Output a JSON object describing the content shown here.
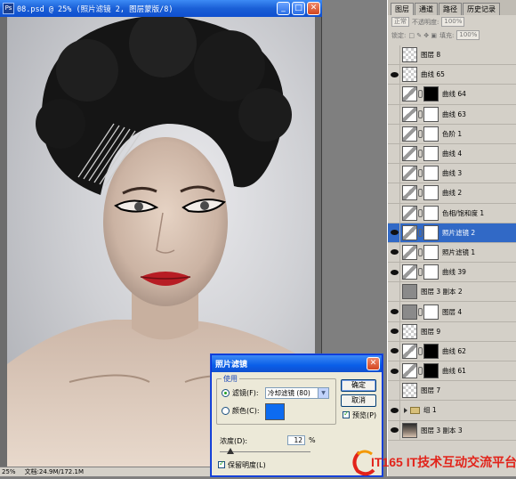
{
  "document": {
    "title": "08.psd @ 25% (照片滤镜 2, 图层蒙版/8)",
    "status_zoom": "25%",
    "status_doc": "文档:24.9M/172.1M"
  },
  "layers_panel": {
    "tabs": [
      "图层",
      "通道",
      "路径",
      "历史记录"
    ],
    "active_tab": "图层",
    "blend_mode": "正常",
    "opacity_label": "不透明度:",
    "opacity_value": "100%",
    "lock_label": "锁定:",
    "fill_label": "填充:",
    "fill_value": "100%",
    "layers": [
      {
        "name": "图层 8",
        "visible": false,
        "thumb": "checker",
        "mask": "none"
      },
      {
        "name": "曲线 65",
        "visible": true,
        "thumb": "checker",
        "mask": "none"
      },
      {
        "name": "曲线 64",
        "visible": false,
        "thumb": "adj",
        "mask": "black"
      },
      {
        "name": "曲线 63",
        "visible": false,
        "thumb": "adj",
        "mask": "white"
      },
      {
        "name": "色阶 1",
        "visible": false,
        "thumb": "adj",
        "mask": "white"
      },
      {
        "name": "曲线 4",
        "visible": false,
        "thumb": "adj",
        "mask": "white"
      },
      {
        "name": "曲线 3",
        "visible": false,
        "thumb": "adj",
        "mask": "white"
      },
      {
        "name": "曲线 2",
        "visible": false,
        "thumb": "adj",
        "mask": "white"
      },
      {
        "name": "色相/饱和度 1",
        "visible": false,
        "thumb": "adj",
        "mask": "white"
      },
      {
        "name": "照片滤镜 2",
        "visible": true,
        "thumb": "adj",
        "mask": "white",
        "selected": true
      },
      {
        "name": "照片滤镜 1",
        "visible": true,
        "thumb": "adj",
        "mask": "white"
      },
      {
        "name": "曲线 39",
        "visible": true,
        "thumb": "adj",
        "mask": "white"
      },
      {
        "name": "图层 3 副本 2",
        "visible": false,
        "thumb": "gray",
        "mask": "none"
      },
      {
        "name": "图层 4",
        "visible": true,
        "thumb": "gray",
        "mask": "white"
      },
      {
        "name": "图层 9",
        "visible": true,
        "thumb": "checker",
        "mask": "none"
      },
      {
        "name": "曲线 62",
        "visible": true,
        "thumb": "adj",
        "mask": "black"
      },
      {
        "name": "曲线 61",
        "visible": true,
        "thumb": "adj",
        "mask": "black"
      },
      {
        "name": "图层 7",
        "visible": false,
        "thumb": "checker",
        "mask": "none"
      },
      {
        "name": "组 1",
        "visible": true,
        "thumb": "folder",
        "mask": "none"
      },
      {
        "name": "图层 3 副本 3",
        "visible": true,
        "thumb": "photo",
        "mask": "none"
      }
    ]
  },
  "dialog": {
    "title": "照片滤镜",
    "group_label": "使用",
    "filter_radio_label": "滤镜(F):",
    "filter_value": "冷却滤镜 (80)",
    "color_radio_label": "颜色(C):",
    "color_value": "#0d6bf0",
    "ok_label": "确定",
    "cancel_label": "取消",
    "preview_label": "预览(P)",
    "preview_checked": true,
    "density_label": "浓度(D):",
    "density_value": "12",
    "density_unit": "%",
    "density_fraction": 0.12,
    "preserve_label": "保留明度(L)",
    "preserve_checked": true
  },
  "watermark": {
    "text": "IT165 IT技术互动交流平台"
  },
  "colors": {
    "selection": "#3169c6",
    "titlebar": "#0f4fcf",
    "panel_bg": "#d4d0c8"
  }
}
